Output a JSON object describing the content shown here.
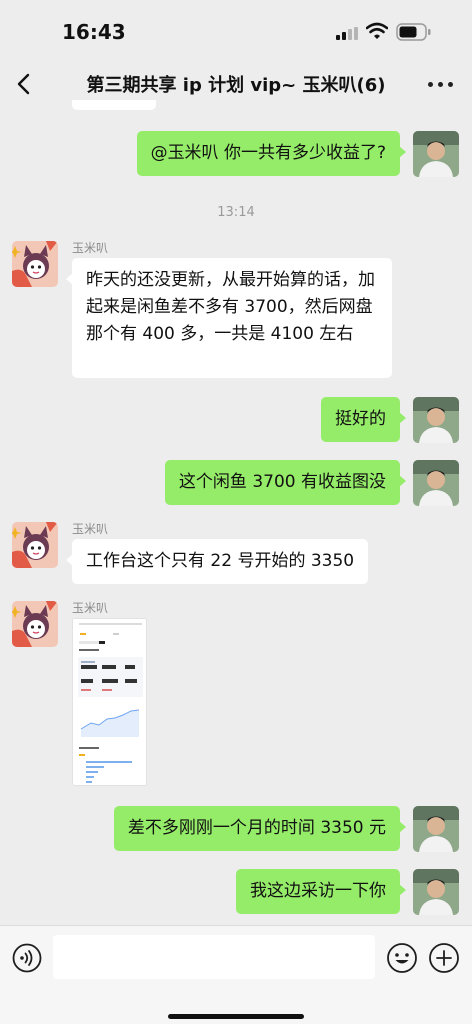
{
  "status_bar": {
    "time": "16:43"
  },
  "header": {
    "title": "第三期共享 ip 计划 vip~ 玉米叭(6)"
  },
  "messages": [
    {
      "text": "@玉米叭 你一共有多少收益了?"
    },
    {
      "timestamp": "13:14"
    },
    {
      "sender": "玉米叭",
      "text": "昨天的还没更新，从最开始算的话，加起来是闲鱼差不多有 3700，然后网盘那个有 400 多，一共是 4100 左右"
    },
    {
      "text": "挺好的"
    },
    {
      "text": "这个闲鱼 3700 有收益图没"
    },
    {
      "sender": "玉米叭",
      "text": "工作台这个只有 22 号开始的 3350"
    },
    {
      "sender": "玉米叭",
      "image": "screenshot-thumbnail"
    },
    {
      "text": "差不多刚刚一个月的时间 3350 元"
    },
    {
      "text": "我这边采访一下你"
    }
  ],
  "colors": {
    "own_bubble": "#95ec69",
    "other_bubble": "#ffffff",
    "background": "#ededed",
    "input_bar": "#f6f6f6"
  },
  "icons": {
    "back": "chevron-left-icon",
    "more": "more-dots-icon",
    "voice": "voice-icon",
    "emoji": "emoji-icon",
    "plus": "plus-icon"
  }
}
